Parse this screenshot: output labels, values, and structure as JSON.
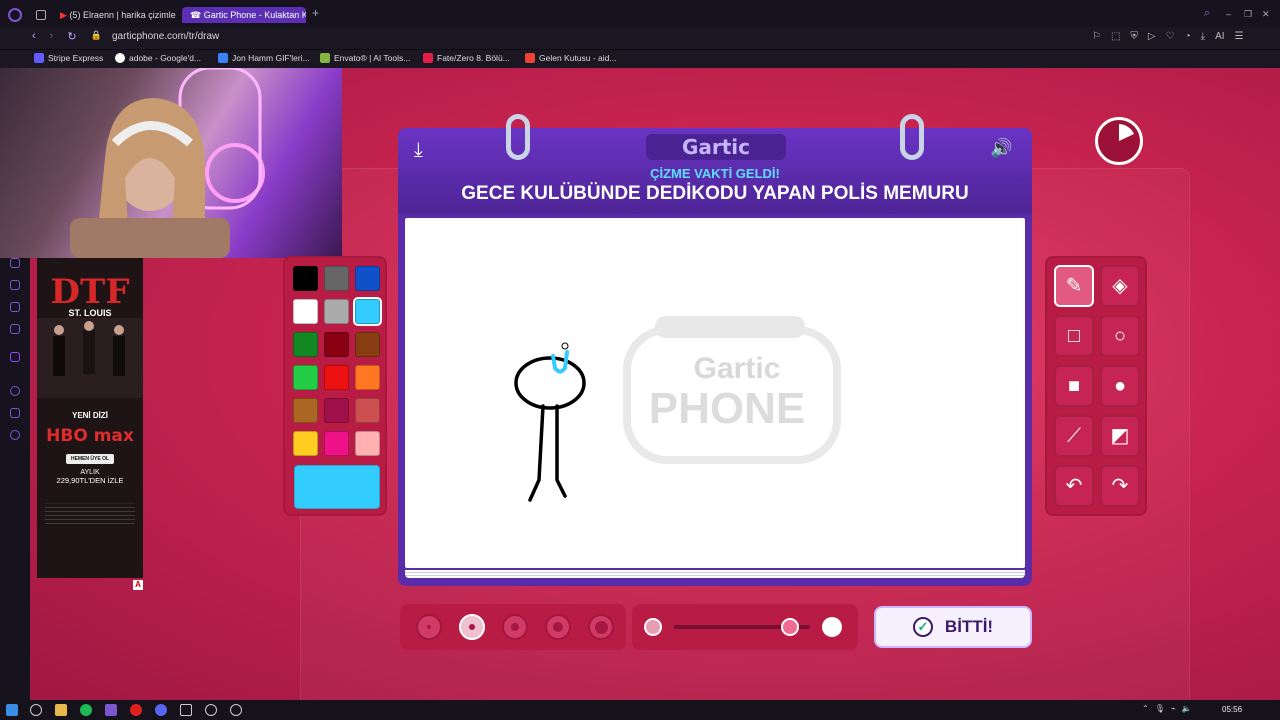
{
  "browser": {
    "tabs": [
      {
        "title": "(5) Elraenn | harika çizimle"
      },
      {
        "title": "Gartic Phone - Kulaktan Ku"
      }
    ],
    "url": "garticphone.com/tr/draw",
    "bookmarks": [
      {
        "label": "Stripe Express",
        "color": "#635bff"
      },
      {
        "label": "adobe - Google'd...",
        "color": "#4285f4"
      },
      {
        "label": "Jon Hamm GIF'leri...",
        "color": "#3b82f6"
      },
      {
        "label": "Envato® | AI Tools...",
        "color": "#82b541"
      },
      {
        "label": "Fate/Zero 8. Bölü...",
        "color": "#e11d48"
      },
      {
        "label": "Gelen Kutusu - aid...",
        "color": "#ea4335"
      }
    ]
  },
  "ad": {
    "title": "DTF",
    "subtitle": "ST. LOUIS",
    "series_label": "YENİ DİZİ",
    "brand": "HBO max",
    "cta": "HEMEN ÜYE OL",
    "price_line1": "AYLIK",
    "price_line2": "229,90TL'DEN İZLE",
    "badge": "A"
  },
  "game": {
    "logo": "Gartic",
    "subheading": "ÇİZME VAKTİ GELDİ!",
    "prompt": "GECE KULÜBÜNDE DEDİKODU YAPAN POLİS MEMURU",
    "watermark": "Gartic PHONE",
    "done_label": "BİTTİ!",
    "palette": [
      "#000000",
      "#666666",
      "#1050c8",
      "#ffffff",
      "#aaaaaa",
      "#33ccff",
      "#118822",
      "#880011",
      "#883e12",
      "#22cc44",
      "#ee1111",
      "#ff7722",
      "#aa6622",
      "#a0104a",
      "#cc5050",
      "#ffcc22",
      "#ee1188",
      "#ffb0b0"
    ],
    "selected_color": "#33ccff",
    "tools": [
      "pen-icon",
      "eraser-icon",
      "rect-outline-icon",
      "circle-outline-icon",
      "rect-fill-icon",
      "circle-fill-icon",
      "line-icon",
      "bucket-icon",
      "undo-icon",
      "redo-icon"
    ],
    "selected_tool": "pen-icon",
    "brush_sizes": [
      1,
      2,
      3,
      4,
      5
    ],
    "selected_size": 2,
    "opacity_level": 0.85
  },
  "taskbar": {
    "time": "05:56"
  }
}
